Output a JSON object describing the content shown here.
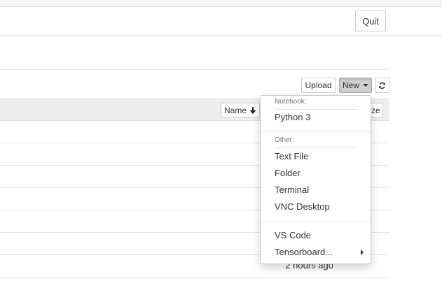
{
  "header": {
    "quit_label": "Quit"
  },
  "toolbar": {
    "upload_label": "Upload",
    "new_label": "New",
    "refresh_icon": "refresh-icon"
  },
  "list": {
    "sort_label": "Name",
    "sort_icon": "arrow-down-icon",
    "partial_header_text": "ze",
    "rows": [
      {
        "time": ""
      },
      {
        "time": ""
      },
      {
        "time": ""
      },
      {
        "time": ""
      },
      {
        "time": ""
      },
      {
        "time": ""
      },
      {
        "time": "2 hours ago"
      }
    ]
  },
  "new_menu": {
    "notebook_header": "Notebook:",
    "notebook_items": [
      "Python 3"
    ],
    "other_header": "Other:",
    "other_items": [
      "Text File",
      "Folder",
      "Terminal",
      "VNC Desktop"
    ],
    "extra_items": [
      "VS Code",
      "Tensorboard..."
    ]
  }
}
